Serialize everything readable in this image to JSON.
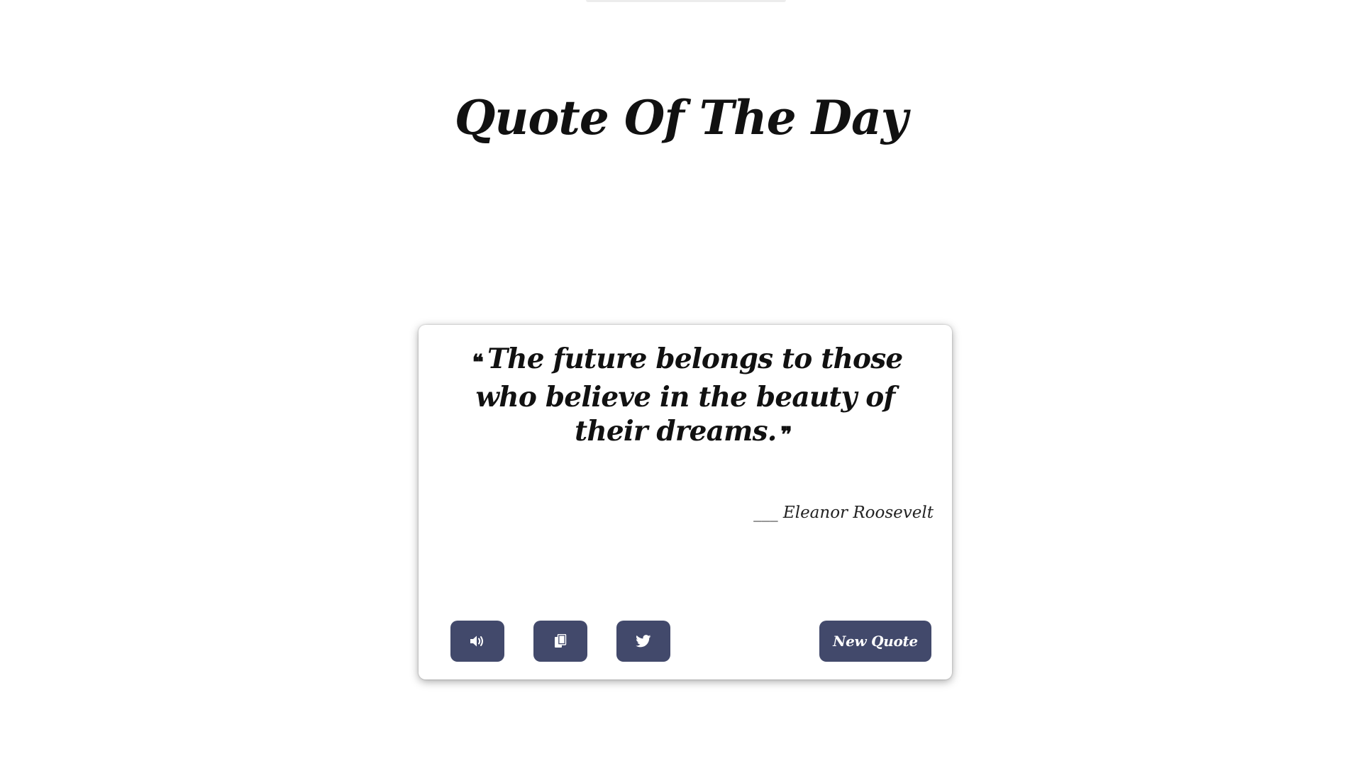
{
  "page": {
    "title": "Quote Of The Day"
  },
  "quote": {
    "open_mark": "❝",
    "text": "The future belongs to those who believe in the beauty of their dreams.",
    "close_mark": "❞",
    "author": "___ Eleanor Roosevelt"
  },
  "actions": {
    "speak_icon": "volume-icon",
    "copy_icon": "copy-icon",
    "tweet_icon": "twitter-icon",
    "new_quote_label": "New Quote"
  },
  "colors": {
    "button_bg": "#42496b",
    "button_text": "#ffffff",
    "text": "#111111"
  }
}
